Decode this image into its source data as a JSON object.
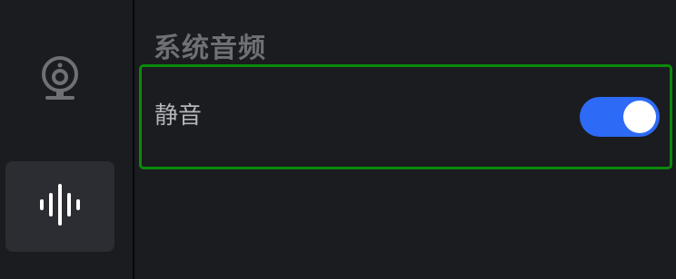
{
  "sidebar": {
    "items": [
      {
        "icon": "webcam-icon",
        "selected": false
      },
      {
        "icon": "audio-waveform-icon",
        "selected": true
      }
    ]
  },
  "main": {
    "section_title": "系统音频",
    "settings": [
      {
        "label": "静音",
        "enabled": true
      }
    ]
  },
  "colors": {
    "toggle_on": "#2d6af6",
    "highlight_border": "#0a8a0a",
    "selected_nav_bg": "#2b2d33"
  }
}
